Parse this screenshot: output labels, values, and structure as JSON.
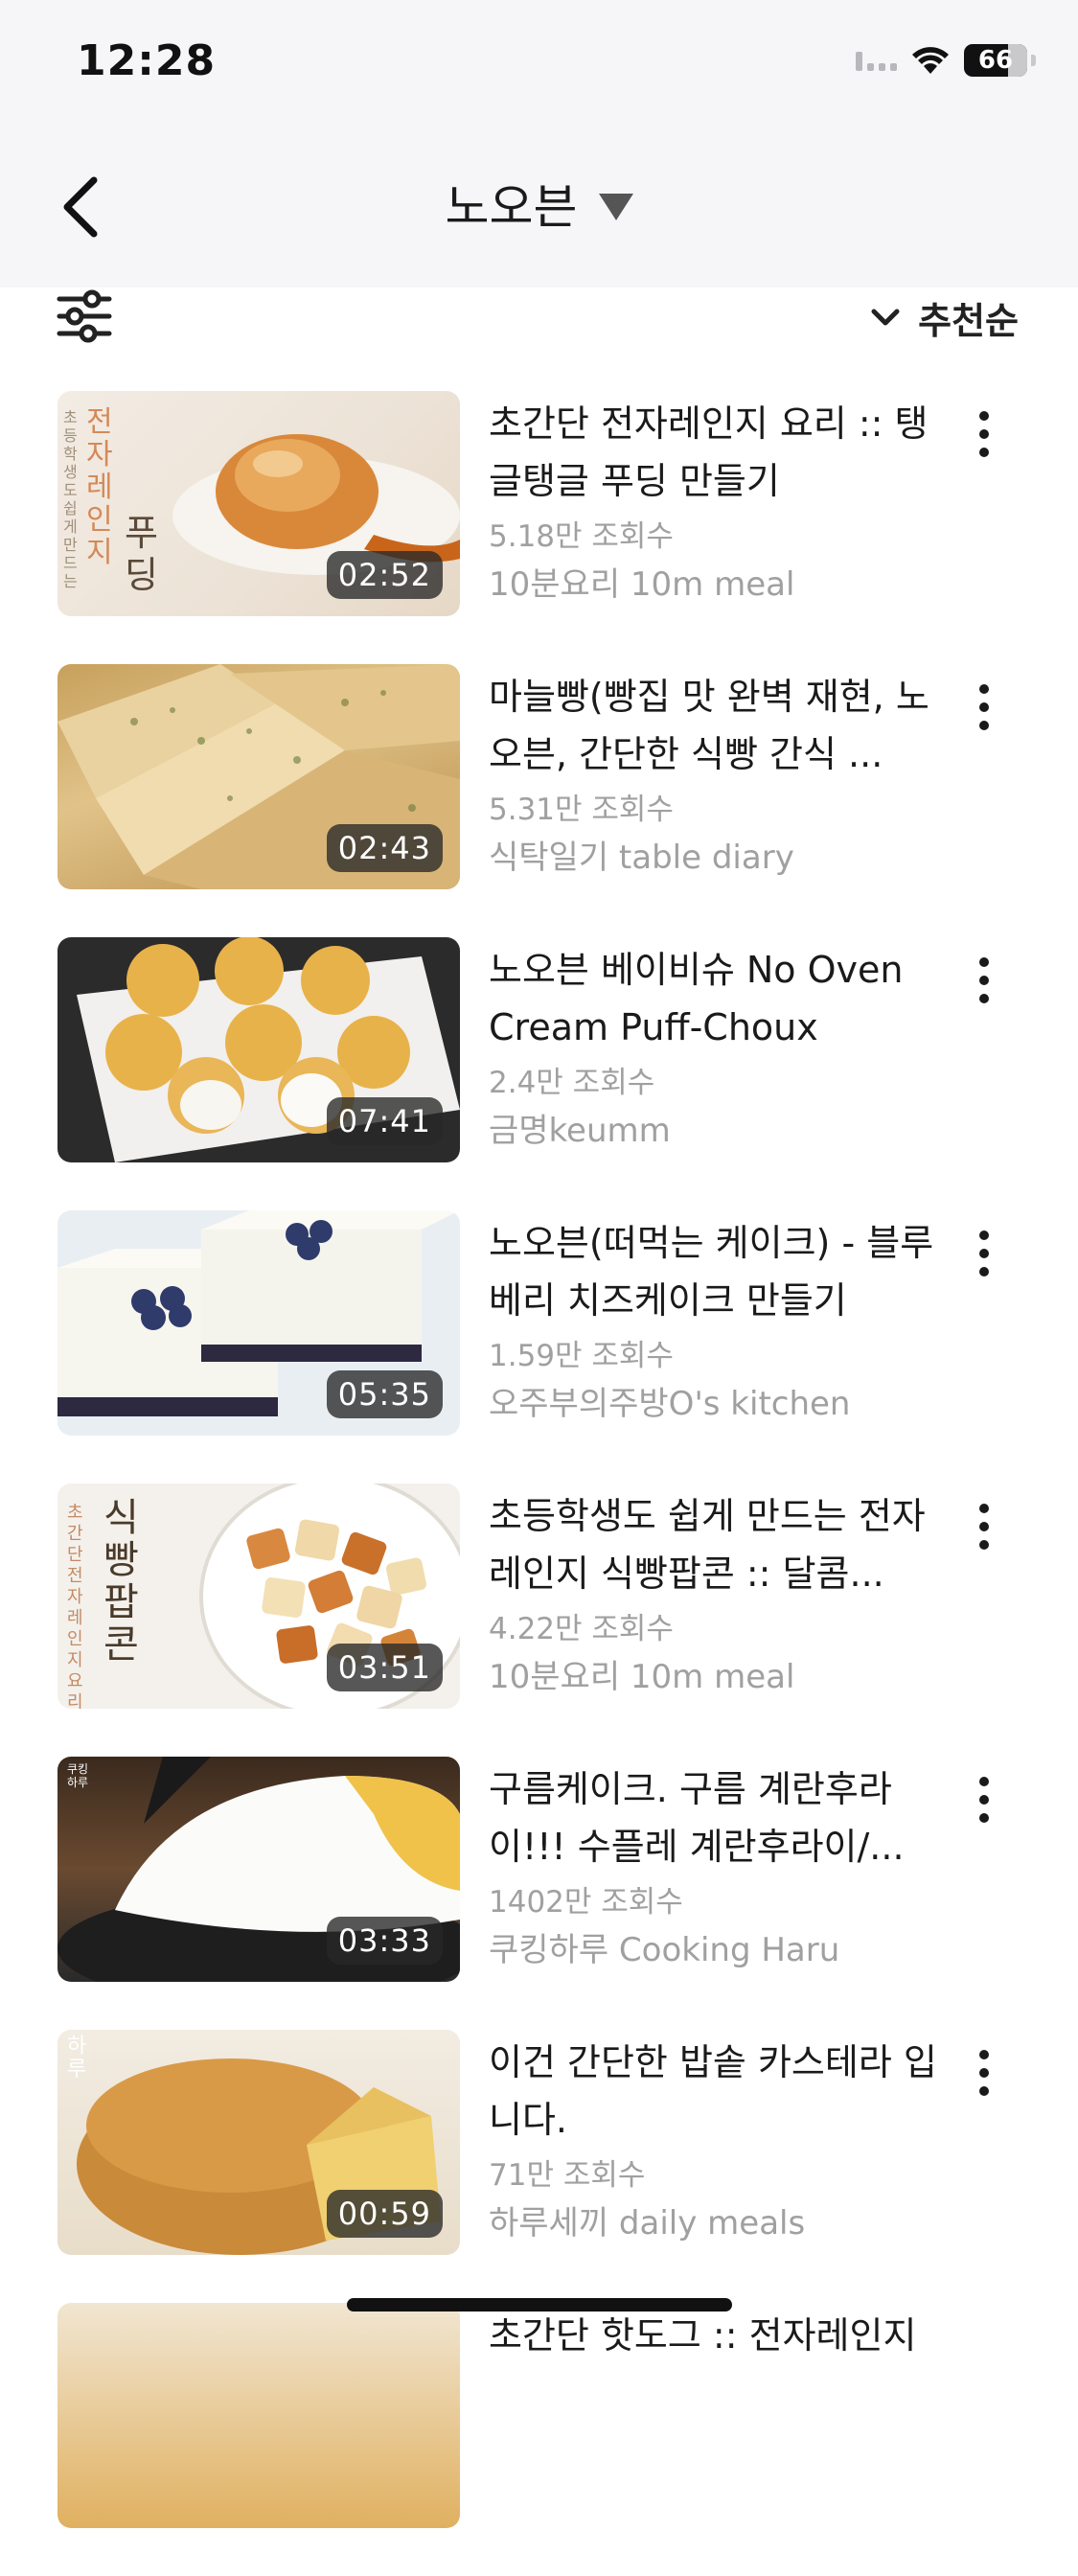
{
  "status_bar": {
    "time": "12:28",
    "battery": "66"
  },
  "nav": {
    "title": "노오븐",
    "back_icon": "chevron-left-icon"
  },
  "filter_bar": {
    "filter_icon": "sliders-icon",
    "sort_label": "추천순"
  },
  "videos": [
    {
      "title": "초간단 전자레인지 요리 :: 탱글탱글 푸딩 만들기",
      "views": "5.18만 조회수",
      "channel": "10분요리 10m meal",
      "duration": "02:52",
      "thumb_overlay": [
        "전자레인지",
        "푸딩",
        "초등학생도 쉽게 만드는"
      ]
    },
    {
      "title": "마늘빵(빵집 맛 완벽 재현, 노오븐, 간단한 식빵 간식 ...",
      "views": "5.31만 조회수",
      "channel": "식탁일기 table diary",
      "duration": "02:43"
    },
    {
      "title": "노오븐 베이비슈 No Oven Cream Puff-Choux",
      "views": "2.4만 조회수",
      "channel": "금명keumm",
      "duration": "07:41"
    },
    {
      "title": "노오븐(떠먹는 케이크) - 블루베리 치즈케이크 만들기",
      "views": "1.59만 조회수",
      "channel": "오주부의주방O's kitchen",
      "duration": "05:35"
    },
    {
      "title": "초등학생도 쉽게 만드는 전자레인지 식빵팝콘 :: 달콤...",
      "views": "4.22만 조회수",
      "channel": "10분요리 10m meal",
      "duration": "03:51",
      "thumb_overlay": [
        "식빵팝콘",
        "초간단 전자레인지 요리"
      ]
    },
    {
      "title": "구름케이크. 구름 계란후라이!!! 수플레 계란후라이/...",
      "views": "1402만 조회수",
      "channel": "쿠킹하루 Cooking Haru",
      "duration": "03:33",
      "thumb_overlay": [
        "쿠킹하루"
      ]
    },
    {
      "title": "이건 간단한 밥솥 카스테라 입니다.",
      "views": "71만 조회수",
      "channel": "하루세끼 daily meals",
      "duration": "00:59",
      "thumb_overlay": [
        "하루"
      ]
    },
    {
      "title": "초간단 핫도그 :: 전자레인지",
      "views": "",
      "channel": "",
      "duration": ""
    }
  ]
}
